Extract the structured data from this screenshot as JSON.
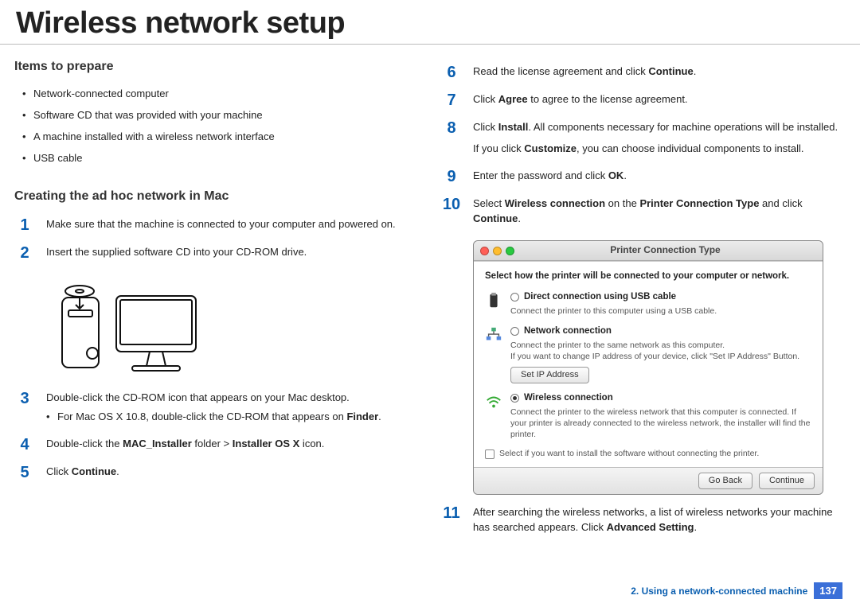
{
  "title": "Wireless network setup",
  "left": {
    "h_items": "Items to prepare",
    "items": [
      "Network-connected computer",
      "Software CD that was provided with your machine",
      "A machine installed with a wireless network interface",
      "USB cable"
    ],
    "h_create": "Creating the ad hoc network in Mac",
    "s1": "Make sure that the machine is connected to your computer and powered on.",
    "s2": "Insert the supplied software CD into your CD-ROM drive.",
    "s3": "Double-click the CD-ROM icon that appears on your Mac desktop.",
    "s3sub_pre": "For Mac OS X 10.8, double-click the CD-ROM that appears on ",
    "s3sub_b": "Finder",
    "s3sub_post": ".",
    "s4_pre": "Double-click the ",
    "s4_b1": "MAC_Installer",
    "s4_mid": " folder > ",
    "s4_b2": "Installer OS X",
    "s4_post": " icon.",
    "s5_pre": "Click ",
    "s5_b": "Continue",
    "s5_post": "."
  },
  "right": {
    "s6_pre": "Read the license agreement and click ",
    "s6_b": "Continue",
    "s6_post": ".",
    "s7_pre": "Click ",
    "s7_b": "Agree",
    "s7_post": " to agree to the license agreement.",
    "s8_pre": "Click ",
    "s8_b": "Install",
    "s8_post": ". All components necessary for machine operations will be installed.",
    "s8_extra_pre": "If you click ",
    "s8_extra_b": "Customize",
    "s8_extra_post": ", you can choose individual components to install.",
    "s9_pre": "Enter the password and click ",
    "s9_b": "OK",
    "s9_post": ".",
    "s10_pre": "Select ",
    "s10_b1": "Wireless connection",
    "s10_mid": " on the ",
    "s10_b2": "Printer Connection Type",
    "s10_mid2": " and click ",
    "s10_b3": "Continue",
    "s10_post": ".",
    "s11_pre": "After searching the wireless networks, a list of wireless networks your machine has searched appears. Click ",
    "s11_b": "Advanced Setting",
    "s11_post": "."
  },
  "dialog": {
    "title": "Printer Connection Type",
    "heading": "Select how the printer will be connected to your computer or network.",
    "usb_label": "Direct connection using USB cable",
    "usb_desc": "Connect the printer to this computer using a USB cable.",
    "net_label": "Network connection",
    "net_desc1": "Connect the printer to the same network as this computer.",
    "net_desc2": "If you want to change IP address of your device, click \"Set IP Address\" Button.",
    "setip_btn": "Set IP Address",
    "wifi_label": "Wireless connection",
    "wifi_desc": "Connect the printer to the wireless network that this computer is connected. If your printer is already connected to the wireless network, the installer will find the printer.",
    "checkbox": "Select if you want to install the software without connecting the printer.",
    "goback": "Go Back",
    "continue": "Continue"
  },
  "footer": {
    "chapter": "2.  Using a network-connected machine",
    "page": "137"
  }
}
